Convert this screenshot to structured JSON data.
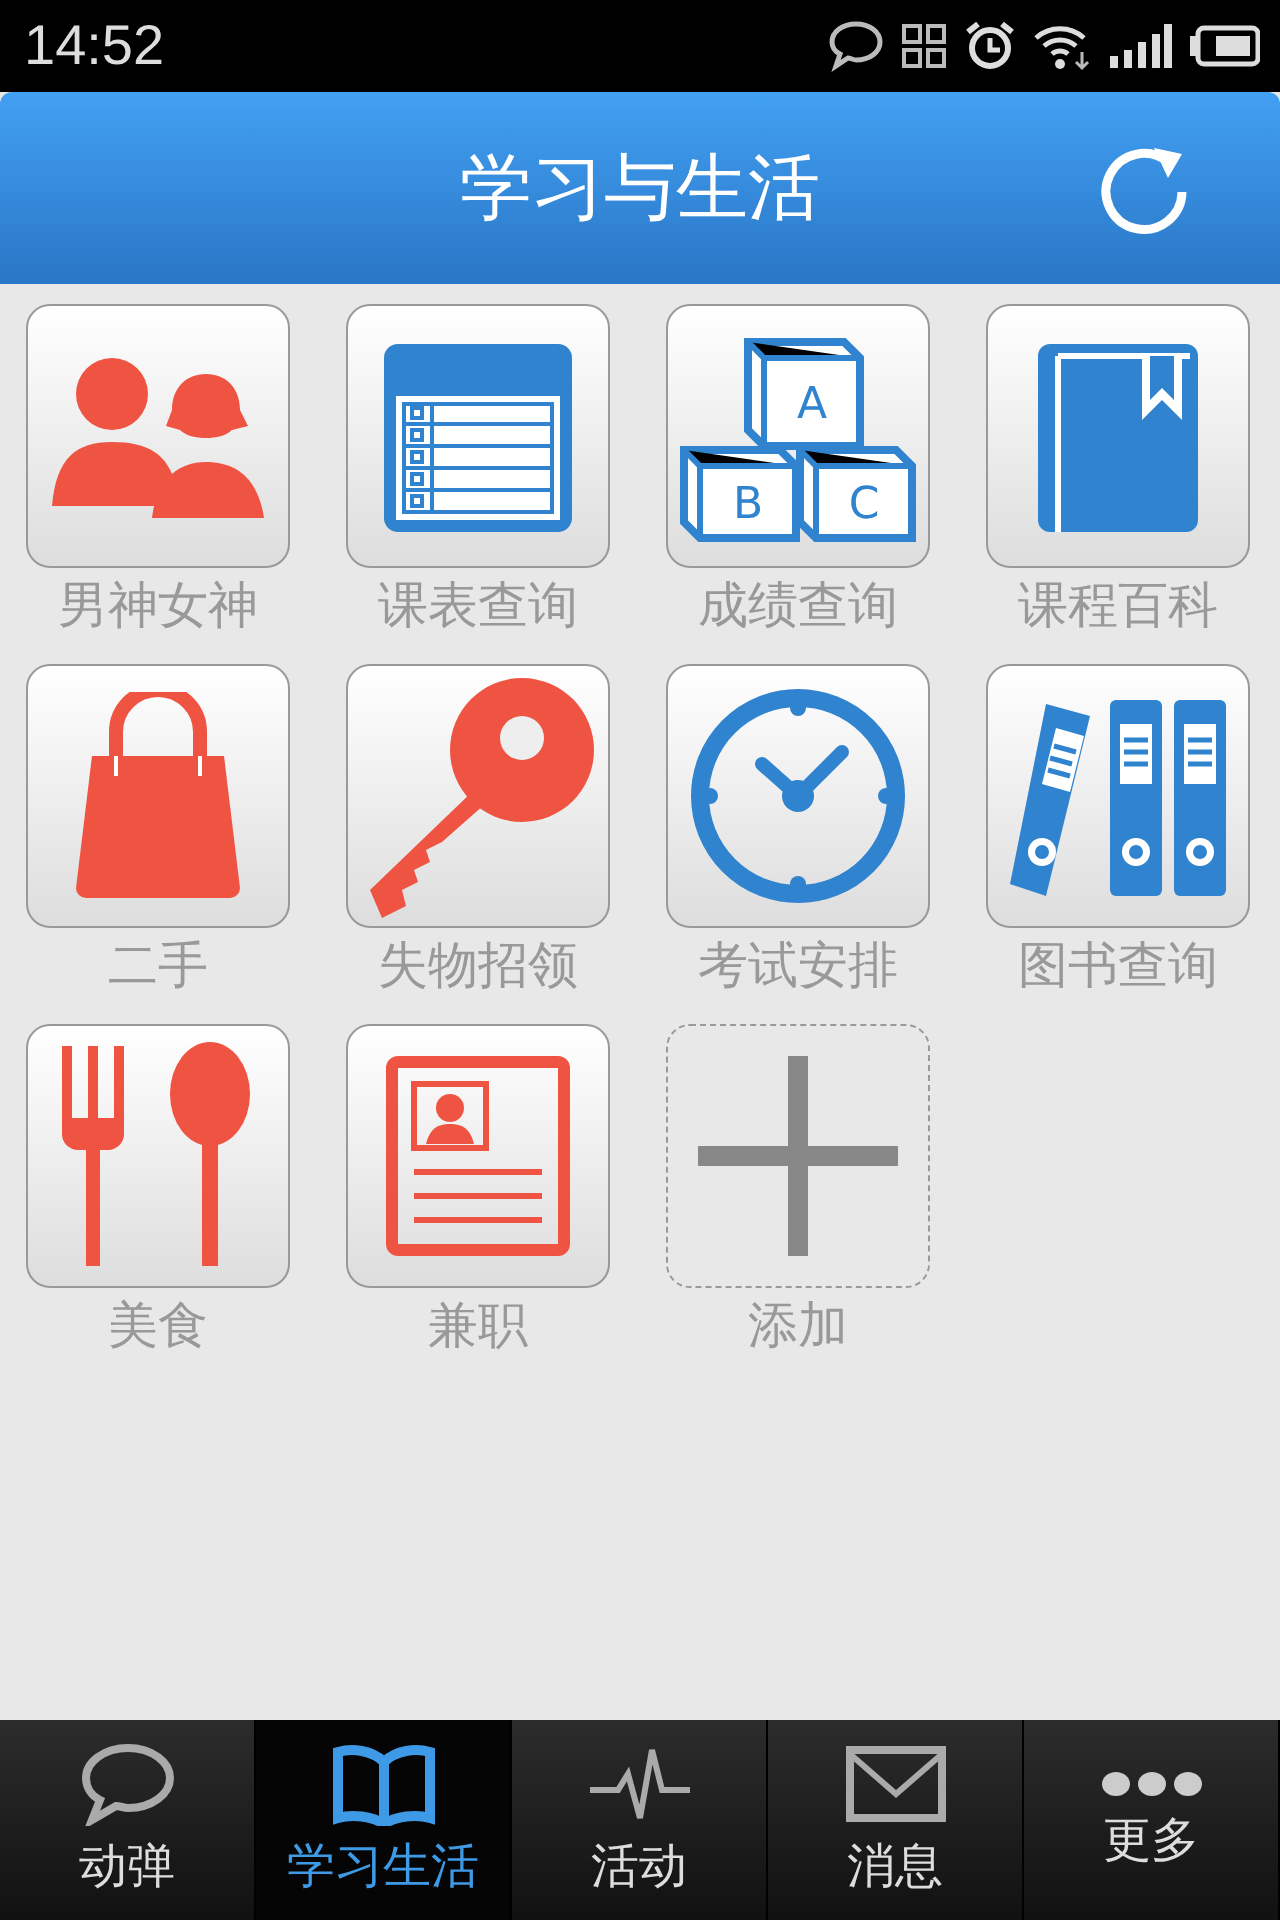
{
  "status_bar": {
    "time": "14:52"
  },
  "header": {
    "title": "学习与生活"
  },
  "tiles": [
    {
      "kind": "people",
      "label": "男神女神"
    },
    {
      "kind": "timetable",
      "label": "课表查询"
    },
    {
      "kind": "blocks",
      "label": "成绩查询",
      "letters": [
        "A",
        "B",
        "C"
      ]
    },
    {
      "kind": "book",
      "label": "课程百科"
    },
    {
      "kind": "bag",
      "label": "二手"
    },
    {
      "kind": "key",
      "label": "失物招领"
    },
    {
      "kind": "clock",
      "label": "考试安排"
    },
    {
      "kind": "binders",
      "label": "图书查询"
    },
    {
      "kind": "food",
      "label": "美食"
    },
    {
      "kind": "idcard",
      "label": "兼职"
    },
    {
      "kind": "add",
      "label": "添加"
    }
  ],
  "tab_bar": [
    {
      "kind": "chat",
      "label": "动弹",
      "selected": false
    },
    {
      "kind": "book",
      "label": "学习生活",
      "selected": true
    },
    {
      "kind": "pulse",
      "label": "活动",
      "selected": false
    },
    {
      "kind": "mail",
      "label": "消息",
      "selected": false
    },
    {
      "kind": "more",
      "label": "更多",
      "selected": false
    }
  ]
}
